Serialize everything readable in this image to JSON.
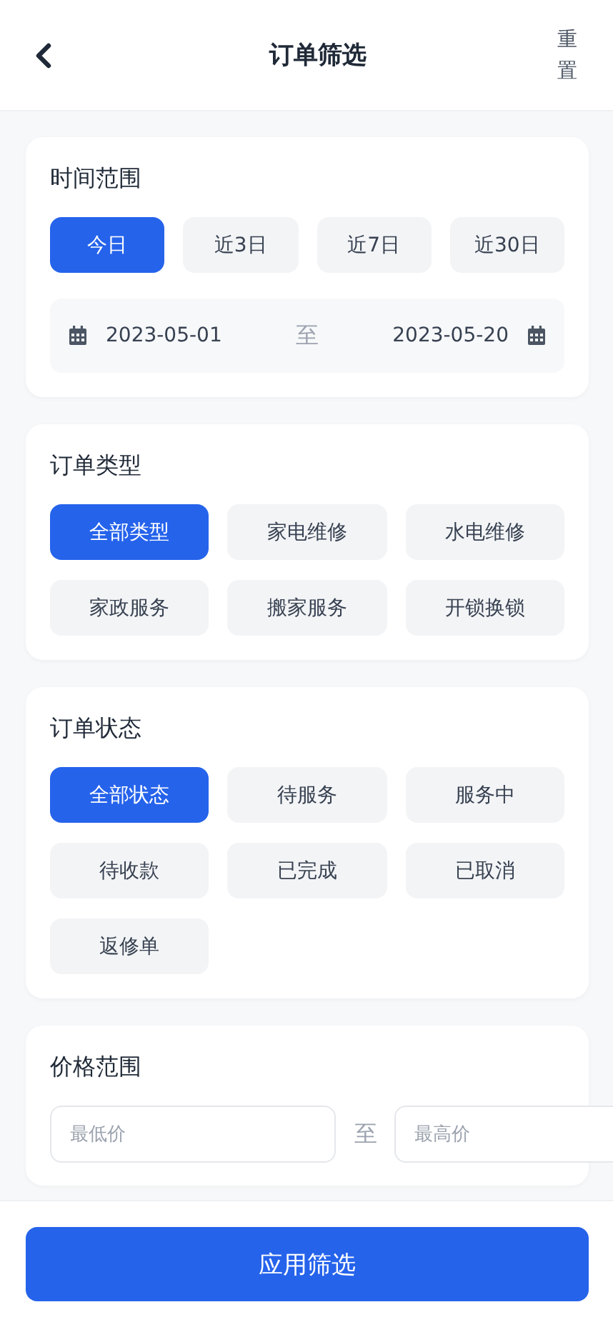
{
  "header": {
    "title": "订单筛选",
    "reset": "重置"
  },
  "time_range": {
    "title": "时间范围",
    "options": [
      {
        "label": "今日",
        "selected": true
      },
      {
        "label": "近3日",
        "selected": false
      },
      {
        "label": "近7日",
        "selected": false
      },
      {
        "label": "近30日",
        "selected": false
      }
    ],
    "start_date": "2023-05-01",
    "separator": "至",
    "end_date": "2023-05-20"
  },
  "order_type": {
    "title": "订单类型",
    "options": [
      {
        "label": "全部类型",
        "selected": true
      },
      {
        "label": "家电维修",
        "selected": false
      },
      {
        "label": "水电维修",
        "selected": false
      },
      {
        "label": "家政服务",
        "selected": false
      },
      {
        "label": "搬家服务",
        "selected": false
      },
      {
        "label": "开锁换锁",
        "selected": false
      }
    ]
  },
  "order_status": {
    "title": "订单状态",
    "options": [
      {
        "label": "全部状态",
        "selected": true
      },
      {
        "label": "待服务",
        "selected": false
      },
      {
        "label": "服务中",
        "selected": false
      },
      {
        "label": "待收款",
        "selected": false
      },
      {
        "label": "已完成",
        "selected": false
      },
      {
        "label": "已取消",
        "selected": false
      },
      {
        "label": "返修单",
        "selected": false
      }
    ]
  },
  "price_range": {
    "title": "价格范围",
    "min": {
      "placeholder": "最低价"
    },
    "separator": "至",
    "max": {
      "placeholder": "最高价"
    }
  },
  "apply_button": "应用筛选"
}
